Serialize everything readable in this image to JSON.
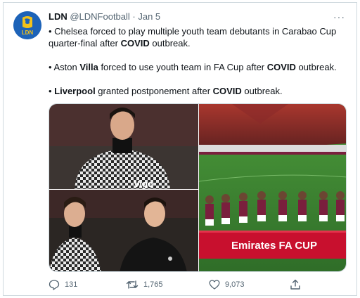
{
  "tweet": {
    "display_name": "LDN",
    "handle": "@LDNFootball",
    "separator": " · ",
    "date": "Jan 5",
    "more_label": "···",
    "avatar_text": "LDN",
    "lines": [
      {
        "parts": [
          "• Chelsea forced to play multiple youth team debutants in Carabao Cup quarter-final after ",
          "COVID",
          " outbreak."
        ]
      },
      {
        "parts": [
          "• Aston ",
          "Villa",
          " forced to use youth team in FA Cup after ",
          "COVID",
          " outbreak."
        ]
      },
      {
        "parts": [
          "• ",
          "Liverpool",
          " granted postponement after ",
          "COVID",
          " outbreak."
        ]
      }
    ]
  },
  "media": {
    "sponsor_text": "Vigo",
    "banner_text": "Emirates FA CUP"
  },
  "actions": {
    "replies": "131",
    "retweets": "1,765",
    "likes": "9,073"
  },
  "colors": {
    "avatar_bg": "#1d63b8",
    "avatar_fg": "#f2c21b",
    "muted": "#536471",
    "banner_red": "#c8102e",
    "pitch_green": "#3f8a34",
    "villa_claret": "#7a1f3d"
  }
}
